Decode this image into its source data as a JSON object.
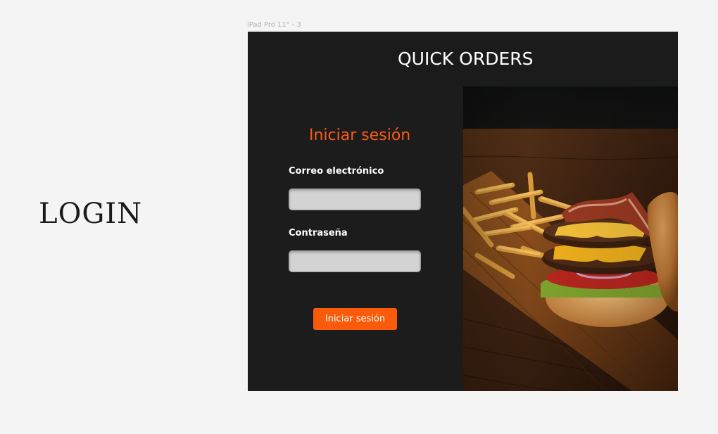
{
  "canvas": {
    "side_title": "LOGIN",
    "frame_label": "iPad Pro 11\" - 3"
  },
  "header": {
    "title": "QUICK ORDERS"
  },
  "form": {
    "title": "Iniciar sesión",
    "email_label": "Correo electrónico",
    "email_value": "",
    "password_label": "Contraseña",
    "password_value": "",
    "submit_label": "Iniciar sesión"
  },
  "colors": {
    "accent": "#fa5c12",
    "frame_bg": "#1c1c1c",
    "input_bg": "#d3d3d3"
  },
  "hero_image": {
    "subject": "burger-with-fries-photo"
  }
}
